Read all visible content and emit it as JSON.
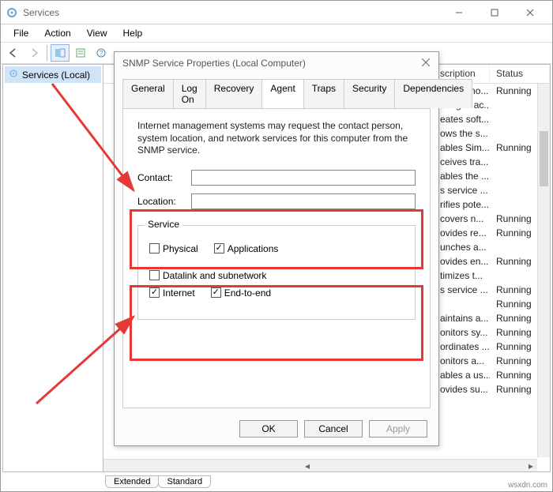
{
  "window": {
    "title": "Services",
    "menubar": [
      "File",
      "Action",
      "View",
      "Help"
    ]
  },
  "left_pane": {
    "item": "Services (Local)"
  },
  "columns": {
    "description": "scription",
    "status": "Status"
  },
  "services": [
    {
      "desc": "ovides no...",
      "status": "Running"
    },
    {
      "desc": "anages ac...",
      "status": ""
    },
    {
      "desc": "eates soft...",
      "status": ""
    },
    {
      "desc": "ows the s...",
      "status": ""
    },
    {
      "desc": "ables Sim...",
      "status": "Running"
    },
    {
      "desc": "ceives tra...",
      "status": ""
    },
    {
      "desc": "ables the ...",
      "status": ""
    },
    {
      "desc": "s service ...",
      "status": ""
    },
    {
      "desc": "rifies pote...",
      "status": ""
    },
    {
      "desc": "covers n...",
      "status": "Running"
    },
    {
      "desc": "ovides re...",
      "status": "Running"
    },
    {
      "desc": "unches a...",
      "status": ""
    },
    {
      "desc": "ovides en...",
      "status": "Running"
    },
    {
      "desc": "timizes t...",
      "status": ""
    },
    {
      "desc": "s service ...",
      "status": "Running"
    },
    {
      "desc": "",
      "status": "Running"
    },
    {
      "desc": "aintains a...",
      "status": "Running"
    },
    {
      "desc": "onitors sy...",
      "status": "Running"
    },
    {
      "desc": "ordinates ...",
      "status": "Running"
    },
    {
      "desc": "onitors a...",
      "status": "Running"
    },
    {
      "desc": "ables a us...",
      "status": "Running"
    },
    {
      "desc": "ovides su...",
      "status": "Running"
    }
  ],
  "bottom_tabs": {
    "extended": "Extended",
    "standard": "Standard"
  },
  "dialog": {
    "title": "SNMP Service Properties (Local Computer)",
    "tabs": [
      "General",
      "Log On",
      "Recovery",
      "Agent",
      "Traps",
      "Security",
      "Dependencies"
    ],
    "active_tab": 3,
    "description": "Internet management systems may request the contact person, system location, and network services for this computer from the SNMP service.",
    "contact_label": "Contact:",
    "contact_value": "",
    "location_label": "Location:",
    "location_value": "",
    "service_legend": "Service",
    "checks": {
      "physical": {
        "label": "Physical",
        "checked": false
      },
      "applications": {
        "label": "Applications",
        "checked": true
      },
      "datalink": {
        "label": "Datalink and subnetwork",
        "checked": false
      },
      "internet": {
        "label": "Internet",
        "checked": true
      },
      "endtoend": {
        "label": "End-to-end",
        "checked": true
      }
    },
    "buttons": {
      "ok": "OK",
      "cancel": "Cancel",
      "apply": "Apply"
    }
  },
  "watermark": "wsxdn.com"
}
